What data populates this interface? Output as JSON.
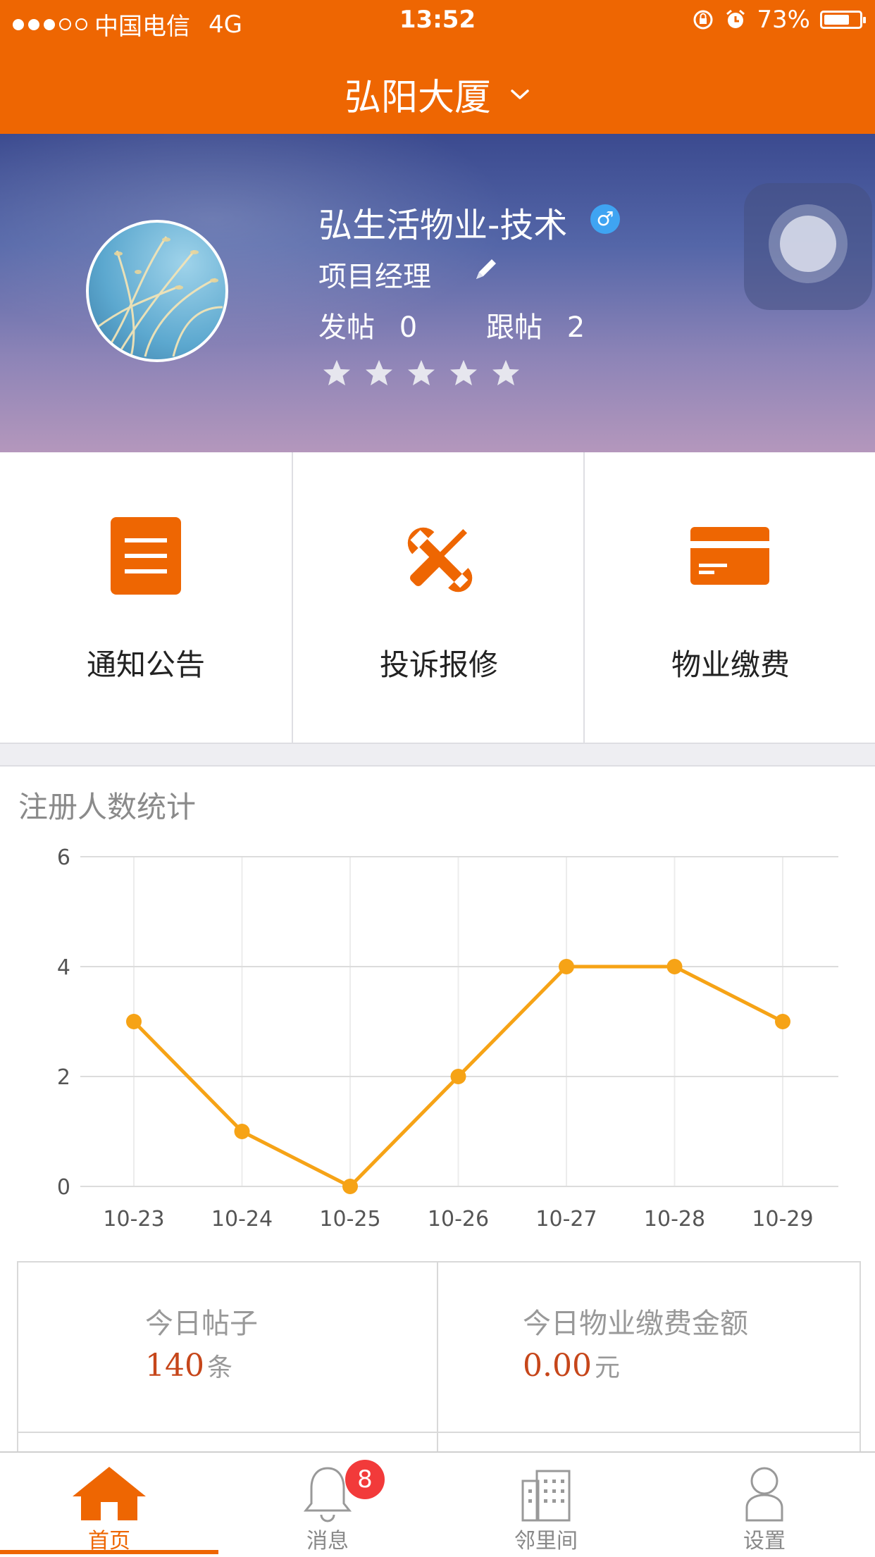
{
  "status_bar": {
    "carrier": "中国电信",
    "network": "4G",
    "time": "13:52",
    "battery": "73%",
    "battery_level": 0.73,
    "signal_bars_filled": 3,
    "signal_bars_total": 5
  },
  "header": {
    "title": "弘阳大厦"
  },
  "profile": {
    "name": "弘生活物业-技术",
    "gender_symbol": "♂",
    "role": "项目经理",
    "posts_label": "发帖",
    "posts_count": "0",
    "replies_label": "跟帖",
    "replies_count": "2",
    "rating_stars": 5
  },
  "features": [
    {
      "label": "通知公告",
      "icon": "document-list-icon"
    },
    {
      "label": "投诉报修",
      "icon": "wrench-screwdriver-icon"
    },
    {
      "label": "物业缴费",
      "icon": "credit-card-icon"
    }
  ],
  "chart_section": {
    "title": "注册人数统计"
  },
  "chart_data": {
    "type": "line",
    "title": "注册人数统计",
    "categories": [
      "10-23",
      "10-24",
      "10-25",
      "10-26",
      "10-27",
      "10-28",
      "10-29"
    ],
    "values": [
      3,
      1,
      0,
      2,
      4,
      4,
      3
    ],
    "ylim": [
      0,
      6
    ],
    "yticks": [
      "0",
      "2",
      "4",
      "6"
    ],
    "grid": true,
    "color": "#f6a316"
  },
  "stats": [
    {
      "label": "今日帖子",
      "value": "140",
      "unit": "条"
    },
    {
      "label": "今日物业缴费金额",
      "value": "0.00",
      "unit": "元"
    }
  ],
  "tabbar": {
    "items": [
      {
        "label": "首页",
        "icon": "home-icon",
        "active": true
      },
      {
        "label": "消息",
        "icon": "bell-icon",
        "active": false,
        "badge": "8"
      },
      {
        "label": "邻里间",
        "icon": "building-icon",
        "active": false
      },
      {
        "label": "设置",
        "icon": "user-icon",
        "active": false
      }
    ]
  },
  "colors": {
    "brand": "#ee6602",
    "chart_line": "#f6a316",
    "value_text": "#c6461a",
    "badge": "#f23a3a"
  }
}
